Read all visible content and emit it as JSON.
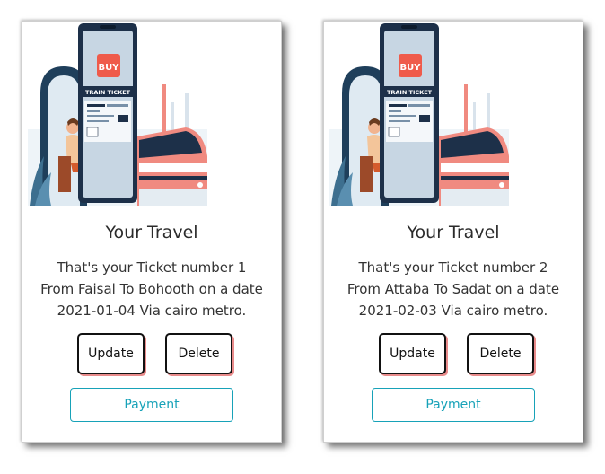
{
  "tickets": [
    {
      "title": "Your Travel",
      "text": "That's your Ticket number 1 From Faisal To Bohooth on a date 2021-01-04 Via cairo metro.",
      "update_label": "Update",
      "delete_label": "Delete",
      "payment_label": "Payment",
      "image": {
        "buy_label": "BUY",
        "ticket_label": "TRAIN TICKET"
      }
    },
    {
      "title": "Your Travel",
      "text": "That's your Ticket number 2 From Attaba To Sadat on a date 2021-02-03 Via cairo metro.",
      "update_label": "Update",
      "delete_label": "Delete",
      "payment_label": "Payment",
      "image": {
        "buy_label": "BUY",
        "ticket_label": "TRAIN TICKET"
      }
    }
  ],
  "colors": {
    "payment_accent": "#17a2b8",
    "button_shadow": "#e98b8b",
    "buy_red": "#ef5b4b",
    "train_pink": "#f08a80"
  }
}
